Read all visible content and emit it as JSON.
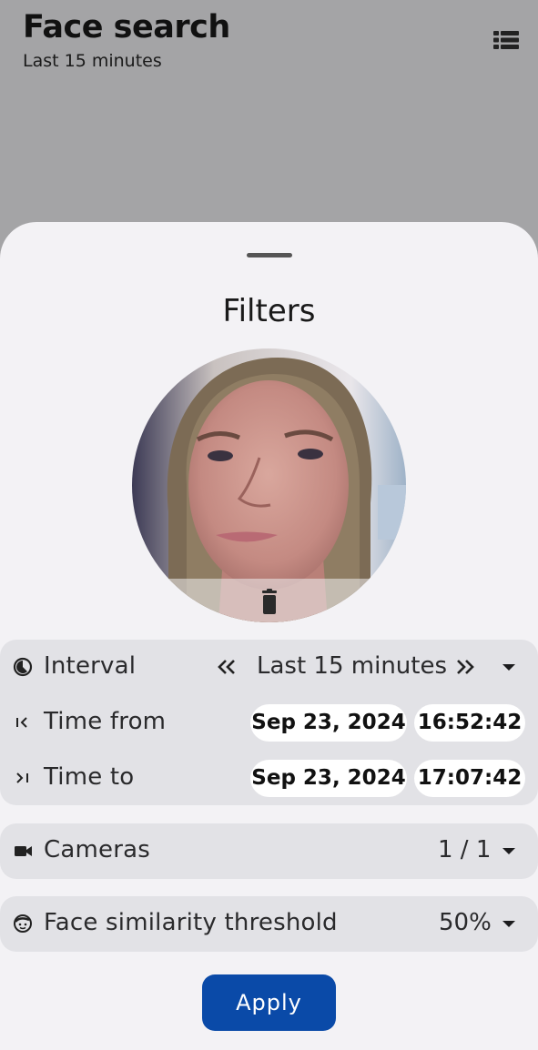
{
  "header": {
    "title": "Face search",
    "subtitle": "Last 15 minutes",
    "list_icon": "list-icon"
  },
  "sheet": {
    "title": "Filters",
    "face_photo_icon": "face-photo",
    "delete_icon": "trash-icon"
  },
  "interval": {
    "icon": "interval-icon",
    "label": "Interval",
    "value": "Last 15 minutes",
    "prev_icon": "double-chevron-left-icon",
    "next_icon": "double-chevron-right-icon"
  },
  "time_from": {
    "icon": "time-from-icon",
    "label": "Time from",
    "date": "Sep 23, 2024",
    "time": "16:52:42"
  },
  "time_to": {
    "icon": "time-to-icon",
    "label": "Time to",
    "date": "Sep 23, 2024",
    "time": "17:07:42"
  },
  "cameras": {
    "icon": "camera-icon",
    "label": "Cameras",
    "value": "1 / 1"
  },
  "threshold": {
    "icon": "face-icon",
    "label": "Face similarity threshold",
    "value": "50%"
  },
  "apply_label": "Apply",
  "colors": {
    "backdrop": "#a4a4a6",
    "sheet": "#f3f2f5",
    "group": "#e2e2e6",
    "accent": "#0a4aa8"
  }
}
